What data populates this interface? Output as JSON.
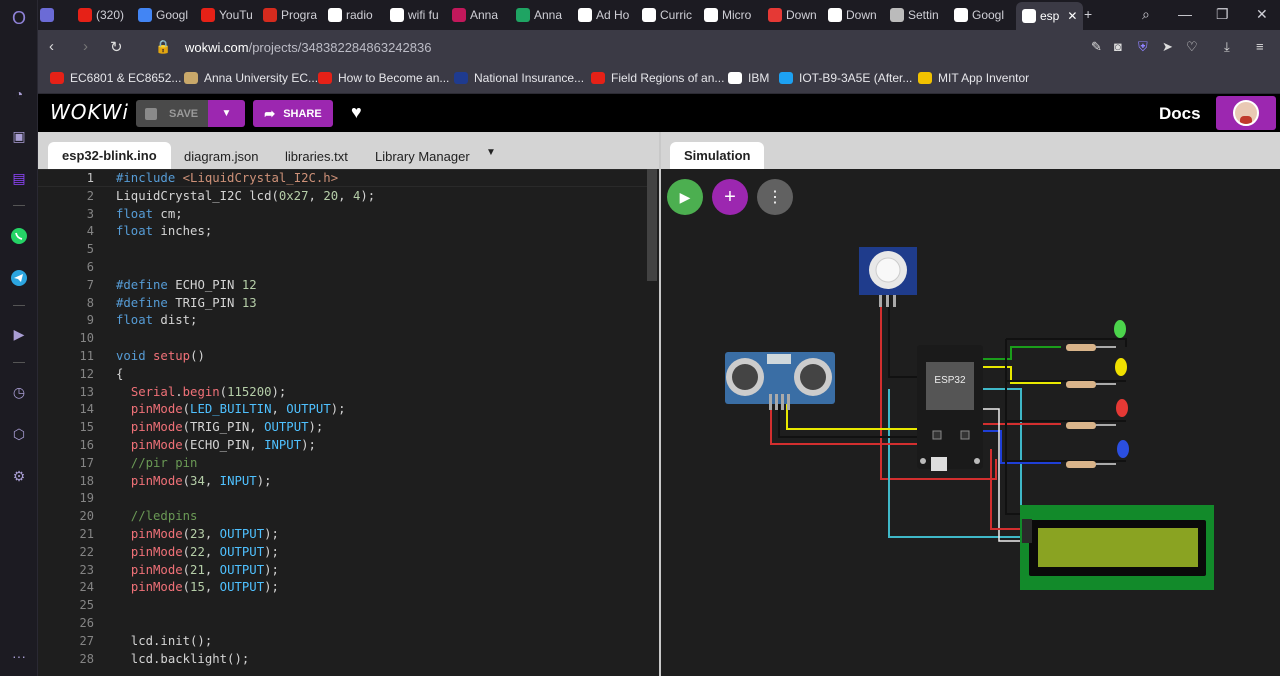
{
  "browser": {
    "tabs": [
      {
        "label": "",
        "color": "#6b6bd6",
        "icon": "discord-icon"
      },
      {
        "label": "(320)",
        "color": "#e62117",
        "icon": "youtube-icon"
      },
      {
        "label": "Googl",
        "color": "#4285f4",
        "icon": "google-icon"
      },
      {
        "label": "YouTu",
        "color": "#e62117",
        "icon": "youtube-icon"
      },
      {
        "label": "Progra",
        "color": "#d52b1e",
        "icon": "maple-leaf-icon"
      },
      {
        "label": "radio",
        "color": "#ffffff",
        "icon": "google-icon"
      },
      {
        "label": "wifi fu",
        "color": "#ffffff",
        "icon": "google-icon"
      },
      {
        "label": "Anna",
        "color": "#c2185b",
        "icon": "anna-icon"
      },
      {
        "label": "Anna",
        "color": "#1fa463",
        "icon": "drive-icon"
      },
      {
        "label": "Ad Ho",
        "color": "#ffffff",
        "icon": "amazon-icon"
      },
      {
        "label": "Curric",
        "color": "#ffffff",
        "icon": "curriculum-icon"
      },
      {
        "label": "Micro",
        "color": "#ffffff",
        "icon": "microsoft-icon"
      },
      {
        "label": "Down",
        "color": "#e53935",
        "icon": "heart-icon"
      },
      {
        "label": "Down",
        "color": "#ffffff",
        "icon": "google-icon"
      },
      {
        "label": "Settin",
        "color": "#bbbbbb",
        "icon": "gear-icon"
      },
      {
        "label": "Googl",
        "color": "#ffffff",
        "icon": "google-icon"
      },
      {
        "label": "esp",
        "color": "#ffffff",
        "icon": "wokwi-icon"
      }
    ],
    "url_host": "wokwi.com",
    "url_path": "/projects/348382284863242836",
    "bookmarks": [
      {
        "label": "EC6801 & EC8652...",
        "color": "#e62117"
      },
      {
        "label": "Anna University EC...",
        "color": "#c9a86a"
      },
      {
        "label": "How to Become an...",
        "color": "#e62117"
      },
      {
        "label": "National Insurance...",
        "color": "#1f3b8f"
      },
      {
        "label": "Field Regions of an...",
        "color": "#e62117"
      },
      {
        "label": "IBM",
        "color": "#ffffff"
      },
      {
        "label": "IOT-B9-3A5E (After...",
        "color": "#1da1f2"
      },
      {
        "label": "MIT App Inventor",
        "color": "#f2c200"
      }
    ]
  },
  "wokwi": {
    "logo": "WOKWi",
    "save_label": "SAVE",
    "share_label": "SHARE",
    "docs_label": "Docs",
    "editor_tabs": [
      "esp32-blink.ino",
      "diagram.json",
      "libraries.txt",
      "Library Manager"
    ],
    "sim_tab": "Simulation",
    "lcd_label": "ESP32"
  },
  "code": {
    "line_numbers": [
      "1",
      "2",
      "3",
      "4",
      "5",
      "6",
      "7",
      "8",
      "9",
      "10",
      "11",
      "12",
      "13",
      "14",
      "15",
      "16",
      "17",
      "18",
      "19",
      "20",
      "21",
      "22",
      "23",
      "24",
      "25",
      "26",
      "27",
      "28"
    ],
    "lines": [
      [
        [
          "#include ",
          "pp"
        ],
        [
          "<LiquidCrystal_I2C.h>",
          "str"
        ]
      ],
      [
        [
          "LiquidCrystal_I2C lcd(",
          ""
        ],
        [
          "0x27",
          "num"
        ],
        [
          ", ",
          ""
        ],
        [
          "20",
          "num"
        ],
        [
          ", ",
          ""
        ],
        [
          "4",
          "num"
        ],
        [
          ");",
          ""
        ]
      ],
      [
        [
          "float",
          "kw"
        ],
        [
          " cm;",
          ""
        ]
      ],
      [
        [
          "float",
          "kw"
        ],
        [
          " inches;",
          ""
        ]
      ],
      [],
      [],
      [
        [
          "#define ",
          "pp"
        ],
        [
          "ECHO_PIN ",
          ""
        ],
        [
          "12",
          "num"
        ]
      ],
      [
        [
          "#define ",
          "pp"
        ],
        [
          "TRIG_PIN ",
          ""
        ],
        [
          "13",
          "num"
        ]
      ],
      [
        [
          "float",
          "kw"
        ],
        [
          " dist;",
          ""
        ]
      ],
      [],
      [
        [
          "void ",
          "kw"
        ],
        [
          "setup",
          "fn"
        ],
        [
          "()",
          ""
        ]
      ],
      [
        [
          "{",
          ""
        ]
      ],
      [
        [
          "  ",
          ""
        ],
        [
          "Serial",
          "fn"
        ],
        [
          ".",
          ""
        ],
        [
          "begin",
          "fn"
        ],
        [
          "(",
          ""
        ],
        [
          "115200",
          "num"
        ],
        [
          ");",
          ""
        ]
      ],
      [
        [
          "  ",
          ""
        ],
        [
          "pinMode",
          "fn"
        ],
        [
          "(",
          ""
        ],
        [
          "LED_BUILTIN",
          "cn"
        ],
        [
          ", ",
          ""
        ],
        [
          "OUTPUT",
          "cn"
        ],
        [
          ");",
          ""
        ]
      ],
      [
        [
          "  ",
          ""
        ],
        [
          "pinMode",
          "fn"
        ],
        [
          "(TRIG_PIN, ",
          ""
        ],
        [
          "OUTPUT",
          "cn"
        ],
        [
          ");",
          ""
        ]
      ],
      [
        [
          "  ",
          ""
        ],
        [
          "pinMode",
          "fn"
        ],
        [
          "(ECHO_PIN, ",
          ""
        ],
        [
          "INPUT",
          "cn"
        ],
        [
          ");",
          ""
        ]
      ],
      [
        [
          "  //pir pin",
          "cm"
        ]
      ],
      [
        [
          "  ",
          ""
        ],
        [
          "pinMode",
          "fn"
        ],
        [
          "(",
          ""
        ],
        [
          "34",
          "num"
        ],
        [
          ", ",
          ""
        ],
        [
          "INPUT",
          "cn"
        ],
        [
          ");",
          ""
        ]
      ],
      [],
      [
        [
          "  //ledpins",
          "cm"
        ]
      ],
      [
        [
          "  ",
          ""
        ],
        [
          "pinMode",
          "fn"
        ],
        [
          "(",
          ""
        ],
        [
          "23",
          "num"
        ],
        [
          ", ",
          ""
        ],
        [
          "OUTPUT",
          "cn"
        ],
        [
          ");",
          ""
        ]
      ],
      [
        [
          "  ",
          ""
        ],
        [
          "pinMode",
          "fn"
        ],
        [
          "(",
          ""
        ],
        [
          "22",
          "num"
        ],
        [
          ", ",
          ""
        ],
        [
          "OUTPUT",
          "cn"
        ],
        [
          ");",
          ""
        ]
      ],
      [
        [
          "  ",
          ""
        ],
        [
          "pinMode",
          "fn"
        ],
        [
          "(",
          ""
        ],
        [
          "21",
          "num"
        ],
        [
          ", ",
          ""
        ],
        [
          "OUTPUT",
          "cn"
        ],
        [
          ");",
          ""
        ]
      ],
      [
        [
          "  ",
          ""
        ],
        [
          "pinMode",
          "fn"
        ],
        [
          "(",
          ""
        ],
        [
          "15",
          "num"
        ],
        [
          ", ",
          ""
        ],
        [
          "OUTPUT",
          "cn"
        ],
        [
          ");",
          ""
        ]
      ],
      [],
      [],
      [
        [
          "  lcd.init();",
          ""
        ]
      ],
      [
        [
          "  lcd.backlight();",
          ""
        ]
      ]
    ]
  },
  "colors": {
    "accent": "#9c27b0",
    "play": "#4caf50",
    "wire_red": "#d32f2f",
    "wire_black": "#111111",
    "wire_green": "#1b9e1b",
    "wire_yellow": "#e8e800",
    "wire_blue": "#1f3fd6",
    "wire_cyan": "#3fb8c8"
  }
}
